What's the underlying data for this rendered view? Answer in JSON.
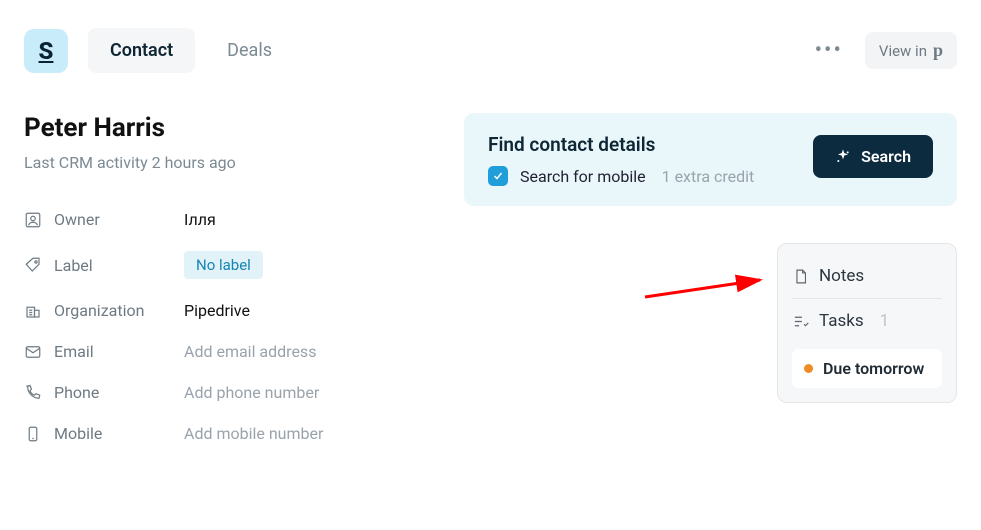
{
  "header": {
    "logo_letter": "S",
    "tabs": [
      {
        "label": "Contact",
        "active": true
      },
      {
        "label": "Deals",
        "active": false
      }
    ],
    "viewin_label": "View in",
    "viewin_glyph": "p"
  },
  "contact": {
    "name": "Peter Harris",
    "last_activity": "Last CRM activity 2 hours ago",
    "fields": {
      "owner": {
        "label": "Owner",
        "value": "Ілля"
      },
      "label": {
        "label": "Label",
        "value": "No label"
      },
      "organization": {
        "label": "Organization",
        "value": "Pipedrive"
      },
      "email": {
        "label": "Email",
        "placeholder": "Add email address"
      },
      "phone": {
        "label": "Phone",
        "placeholder": "Add phone number"
      },
      "mobile": {
        "label": "Mobile",
        "placeholder": "Add mobile number"
      }
    }
  },
  "find_panel": {
    "title": "Find contact details",
    "checkbox_checked": true,
    "option_label": "Search for mobile",
    "extra_text": "1 extra credit",
    "button_label": "Search"
  },
  "side_card": {
    "notes_label": "Notes",
    "tasks_label": "Tasks",
    "tasks_count": "1",
    "due_label": "Due tomorrow"
  }
}
